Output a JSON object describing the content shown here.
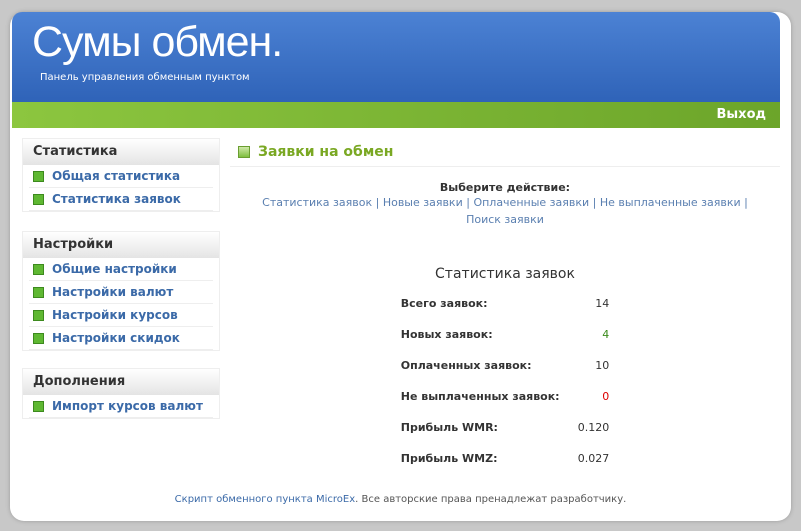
{
  "header": {
    "logo": "Сумы обмен.",
    "subtitle": "Панель управления обменным пунктом",
    "logout": "Выход"
  },
  "sidebar": [
    {
      "title": "Статистика",
      "items": [
        "Общая статистика",
        "Статистика заявок"
      ]
    },
    {
      "title": "Настройки",
      "items": [
        "Общие настройки",
        "Настройки валют",
        "Настройки курсов",
        "Настройки скидок"
      ]
    },
    {
      "title": "Дополнения",
      "items": [
        "Импорт курсов валют"
      ]
    }
  ],
  "main": {
    "title": "Заявки на обмен",
    "action_label": "Выберите действие:",
    "links": [
      "Статистика заявок",
      "Новые заявки",
      "Оплаченные заявки",
      "Не выплаченные заявки",
      "Поиск заявки"
    ],
    "stats_title": "Статистика заявок",
    "stats": [
      {
        "label": "Всего заявок:",
        "value": "14"
      },
      {
        "label": "Новых заявок:",
        "value": "4"
      },
      {
        "label": "Оплаченных заявок:",
        "value": "10"
      },
      {
        "label": "Не выплаченных заявок:",
        "value": "0"
      },
      {
        "label": "Прибыль WMR:",
        "value": "0.120"
      },
      {
        "label": "Прибыль WMZ:",
        "value": "0.027"
      }
    ]
  },
  "footer": {
    "link": "Скрипт обменного пункта MicroEx",
    "text": ". Все авторские права пренадлежат разработчику."
  }
}
